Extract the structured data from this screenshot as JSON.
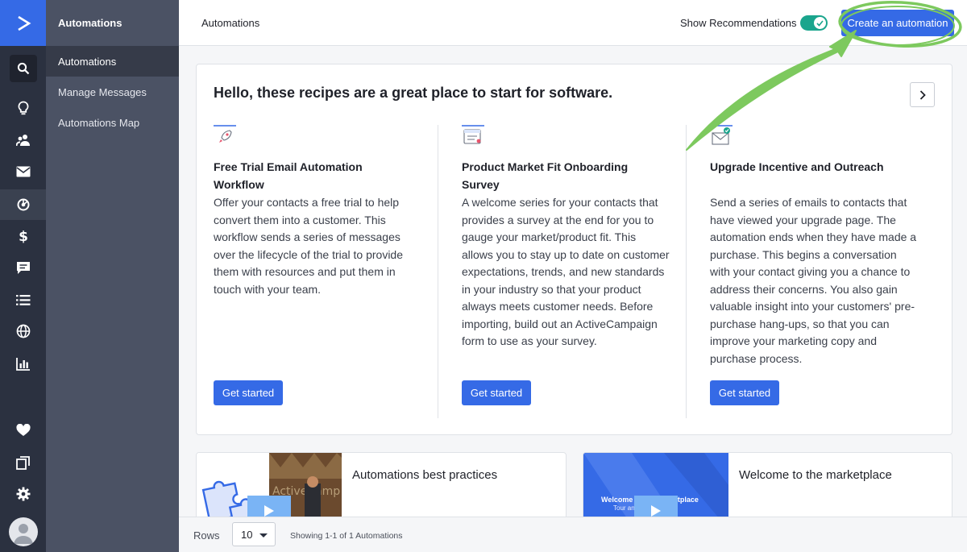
{
  "header": {
    "title": "Automations",
    "show_recommendations_label": "Show Recommendations",
    "show_recommendations_on": true,
    "create_button": "Create an automation"
  },
  "subnav": {
    "title": "Automations",
    "items": [
      {
        "label": "Automations",
        "active": true
      },
      {
        "label": "Manage Messages",
        "active": false
      },
      {
        "label": "Automations Map",
        "active": false
      }
    ]
  },
  "rail_icons": [
    "logo-icon",
    "search-icon",
    "lightbulb-icon",
    "contacts-icon",
    "email-icon",
    "automations-icon",
    "deals-icon",
    "conversations-icon",
    "lists-icon",
    "website-icon",
    "reports-icon",
    "favorites-icon",
    "apps-icon",
    "settings-icon",
    "avatar"
  ],
  "recipes": {
    "heading": "Hello, these recipes are a great place to start for software.",
    "items": [
      {
        "icon": "rocket-icon",
        "title": "Free Trial Email Automation Workflow",
        "description": "Offer your contacts a free trial to help convert them into a customer. This workflow sends a series of messages over the lifecycle of the trial to provide them with resources and put them in touch with your team.",
        "button": "Get started"
      },
      {
        "icon": "survey-icon",
        "title": "Product Market Fit Onboarding Survey",
        "description": "A welcome series for your contacts that provides a survey at the end for you to gauge your market/product fit. This allows you to stay up to date on customer expectations, trends, and new standards in your industry so that your product always meets customer needs. Before importing, build out an ActiveCampaign form to use as your survey.",
        "button": "Get started"
      },
      {
        "icon": "envelope-check-icon",
        "title": "Upgrade Incentive and Outreach",
        "description": "Send a series of emails to contacts that have viewed your upgrade page. The automation ends when they have made a purchase. This begins a conversation with your contact giving you a chance to address their concerns. You also gain valuable insight into your customers' pre-purchase hang-ups, so that you can improve your marketing copy and purchase process.",
        "button": "Get started"
      }
    ]
  },
  "videos": [
    {
      "title": "Automations best practices"
    },
    {
      "title": "Welcome to the marketplace",
      "thumb_caption": "Welcome to the Marketplace",
      "thumb_subcaption": "Tour and ... Recipes"
    }
  ],
  "pager": {
    "rows_label": "Rows",
    "rows_value": "10",
    "showing": "Showing 1-1 of 1 Automations"
  },
  "colors": {
    "primary": "#356ae6",
    "rail": "#2b3140",
    "subnav": "#4b5264",
    "toggle": "#1aa58d",
    "annotation": "#7dc95e"
  }
}
